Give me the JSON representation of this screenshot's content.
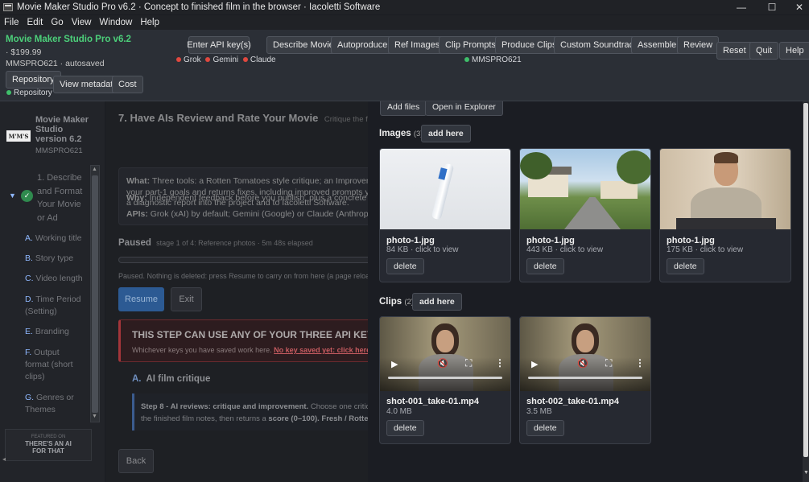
{
  "window": {
    "title": "Movie Maker Studio Pro v6.2 · Concept to finished film in the browser · Iacoletti Software",
    "min": "—",
    "max": "☐",
    "close": "✕"
  },
  "menu": [
    "File",
    "Edit",
    "Go",
    "View",
    "Window",
    "Help"
  ],
  "header": {
    "app_name": "Movie Maker Studio Pro v6.2",
    "price": "· $199.99",
    "project": "MMSPRO621 · autosaved",
    "api_button": "Enter API key(s)",
    "providers": [
      {
        "name": "Grok",
        "color": "#e0483f"
      },
      {
        "name": "Gemini",
        "color": "#e0483f"
      },
      {
        "name": "Claude",
        "color": "#e0483f"
      }
    ],
    "tools": [
      "Describe Movie",
      "Autoproduce",
      "Ref Images",
      "Clip Prompts",
      "Produce Clips",
      "Custom Soundtrack",
      "Assemble",
      "Review"
    ],
    "project_badge": "MMSPRO621",
    "project_badge_color": "#3fbf6a",
    "right_buttons": [
      "Reset",
      "Quit",
      "Help"
    ],
    "repo_button": "Repository",
    "repo_status": "Repository",
    "metadata_button": "View metadata",
    "cost_button": "Cost"
  },
  "sidebar": {
    "logo_text": "M'M'S",
    "title": "Movie Maker Studio version 6.2",
    "code": "MMSPRO621",
    "step1": "1. Describe and Format Your Movie or Ad",
    "items": [
      {
        "letter": "A.",
        "label": "Working title"
      },
      {
        "letter": "B.",
        "label": "Story type"
      },
      {
        "letter": "C.",
        "label": "Video length"
      },
      {
        "letter": "D.",
        "label": "Time Period (Setting)"
      },
      {
        "letter": "E.",
        "label": "Branding"
      },
      {
        "letter": "F.",
        "label": "Output format (short clips)"
      },
      {
        "letter": "G.",
        "label": "Genres or Themes"
      }
    ],
    "featured_top": "FEATURED ON",
    "featured_main": "THERE'S AN AI FOR THAT"
  },
  "main": {
    "heading": "7. Have AIs Review and Rate Your Movie",
    "heading_sub": "Critique the finish",
    "what_label": "What:",
    "what_text": "Three tools: a Rotten Tomatoes style critique; an Improvement",
    "what_text2": "your part-1 goals and returns fixes, including improved prompts you",
    "what_text3": "a diagnostic report into the project and to Iacoletti Software.",
    "why_label": "Why:",
    "why_text": "Independent feedback before you publish, plus a concrete revi",
    "apis_label": "APIs:",
    "apis_text": "Grok (xAI) by default; Gemini (Google) or Claude (Anthropic) se",
    "paused_label": "Paused",
    "paused_meta": "stage 1 of 4: Reference photos · 5m 48s elapsed",
    "paused_note": "Paused. Nothing is deleted: press Resume to carry on from here (a page reload alw",
    "resume": "Resume",
    "exit": "Exit",
    "warn_title": "THIS STEP CAN USE ANY OF YOUR THREE API KEYS",
    "warn_text": "Whichever keys you have saved work here.",
    "warn_link": "No key saved yet: click here to a",
    "section_letter": "A.",
    "section_title": "AI film critique",
    "step_text": "Step 8 - AI reviews: critique and improvement.",
    "step_text_rest": "Choose one critic A",
    "step_line2": "the finished film notes, then returns a",
    "score_text": "score (0–100). Fresh / Rotten",
    "back": "Back"
  },
  "panel": {
    "add_files": "Add files",
    "open_explorer": "Open in Explorer",
    "images_label": "Images",
    "images_count": "(3)",
    "clips_label": "Clips",
    "clips_count": "(2)",
    "add_here": "add here",
    "images": [
      {
        "name": "photo-1.jpg",
        "meta": "84 KB · click to view",
        "delete": "delete",
        "subject": "pen"
      },
      {
        "name": "photo-1.jpg",
        "meta": "443 KB · click to view",
        "delete": "delete",
        "subject": "house"
      },
      {
        "name": "photo-1.jpg",
        "meta": "175 KB · click to view",
        "delete": "delete",
        "subject": "man"
      }
    ],
    "clips": [
      {
        "name": "shot-001_take-01.mp4",
        "meta": "4.0 MB",
        "delete": "delete"
      },
      {
        "name": "shot-002_take-01.mp4",
        "meta": "3.5 MB",
        "delete": "delete"
      }
    ]
  }
}
